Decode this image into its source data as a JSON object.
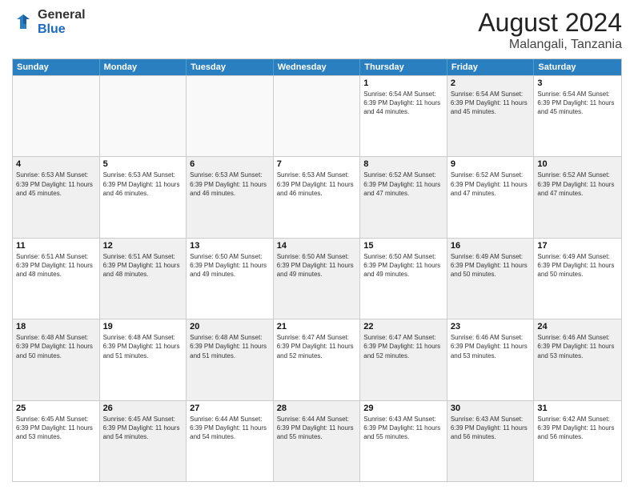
{
  "logo": {
    "general": "General",
    "blue": "Blue"
  },
  "title": {
    "month": "August 2024",
    "location": "Malangali, Tanzania"
  },
  "header_days": [
    "Sunday",
    "Monday",
    "Tuesday",
    "Wednesday",
    "Thursday",
    "Friday",
    "Saturday"
  ],
  "weeks": [
    [
      {
        "day": "",
        "info": "",
        "empty": true
      },
      {
        "day": "",
        "info": "",
        "empty": true
      },
      {
        "day": "",
        "info": "",
        "empty": true
      },
      {
        "day": "",
        "info": "",
        "empty": true
      },
      {
        "day": "1",
        "info": "Sunrise: 6:54 AM\nSunset: 6:39 PM\nDaylight: 11 hours\nand 44 minutes."
      },
      {
        "day": "2",
        "info": "Sunrise: 6:54 AM\nSunset: 6:39 PM\nDaylight: 11 hours\nand 45 minutes.",
        "shaded": true
      },
      {
        "day": "3",
        "info": "Sunrise: 6:54 AM\nSunset: 6:39 PM\nDaylight: 11 hours\nand 45 minutes."
      }
    ],
    [
      {
        "day": "4",
        "info": "Sunrise: 6:53 AM\nSunset: 6:39 PM\nDaylight: 11 hours\nand 45 minutes.",
        "shaded": true
      },
      {
        "day": "5",
        "info": "Sunrise: 6:53 AM\nSunset: 6:39 PM\nDaylight: 11 hours\nand 46 minutes."
      },
      {
        "day": "6",
        "info": "Sunrise: 6:53 AM\nSunset: 6:39 PM\nDaylight: 11 hours\nand 46 minutes.",
        "shaded": true
      },
      {
        "day": "7",
        "info": "Sunrise: 6:53 AM\nSunset: 6:39 PM\nDaylight: 11 hours\nand 46 minutes."
      },
      {
        "day": "8",
        "info": "Sunrise: 6:52 AM\nSunset: 6:39 PM\nDaylight: 11 hours\nand 47 minutes.",
        "shaded": true
      },
      {
        "day": "9",
        "info": "Sunrise: 6:52 AM\nSunset: 6:39 PM\nDaylight: 11 hours\nand 47 minutes."
      },
      {
        "day": "10",
        "info": "Sunrise: 6:52 AM\nSunset: 6:39 PM\nDaylight: 11 hours\nand 47 minutes.",
        "shaded": true
      }
    ],
    [
      {
        "day": "11",
        "info": "Sunrise: 6:51 AM\nSunset: 6:39 PM\nDaylight: 11 hours\nand 48 minutes."
      },
      {
        "day": "12",
        "info": "Sunrise: 6:51 AM\nSunset: 6:39 PM\nDaylight: 11 hours\nand 48 minutes.",
        "shaded": true
      },
      {
        "day": "13",
        "info": "Sunrise: 6:50 AM\nSunset: 6:39 PM\nDaylight: 11 hours\nand 49 minutes."
      },
      {
        "day": "14",
        "info": "Sunrise: 6:50 AM\nSunset: 6:39 PM\nDaylight: 11 hours\nand 49 minutes.",
        "shaded": true
      },
      {
        "day": "15",
        "info": "Sunrise: 6:50 AM\nSunset: 6:39 PM\nDaylight: 11 hours\nand 49 minutes."
      },
      {
        "day": "16",
        "info": "Sunrise: 6:49 AM\nSunset: 6:39 PM\nDaylight: 11 hours\nand 50 minutes.",
        "shaded": true
      },
      {
        "day": "17",
        "info": "Sunrise: 6:49 AM\nSunset: 6:39 PM\nDaylight: 11 hours\nand 50 minutes."
      }
    ],
    [
      {
        "day": "18",
        "info": "Sunrise: 6:48 AM\nSunset: 6:39 PM\nDaylight: 11 hours\nand 50 minutes.",
        "shaded": true
      },
      {
        "day": "19",
        "info": "Sunrise: 6:48 AM\nSunset: 6:39 PM\nDaylight: 11 hours\nand 51 minutes."
      },
      {
        "day": "20",
        "info": "Sunrise: 6:48 AM\nSunset: 6:39 PM\nDaylight: 11 hours\nand 51 minutes.",
        "shaded": true
      },
      {
        "day": "21",
        "info": "Sunrise: 6:47 AM\nSunset: 6:39 PM\nDaylight: 11 hours\nand 52 minutes."
      },
      {
        "day": "22",
        "info": "Sunrise: 6:47 AM\nSunset: 6:39 PM\nDaylight: 11 hours\nand 52 minutes.",
        "shaded": true
      },
      {
        "day": "23",
        "info": "Sunrise: 6:46 AM\nSunset: 6:39 PM\nDaylight: 11 hours\nand 53 minutes."
      },
      {
        "day": "24",
        "info": "Sunrise: 6:46 AM\nSunset: 6:39 PM\nDaylight: 11 hours\nand 53 minutes.",
        "shaded": true
      }
    ],
    [
      {
        "day": "25",
        "info": "Sunrise: 6:45 AM\nSunset: 6:39 PM\nDaylight: 11 hours\nand 53 minutes."
      },
      {
        "day": "26",
        "info": "Sunrise: 6:45 AM\nSunset: 6:39 PM\nDaylight: 11 hours\nand 54 minutes.",
        "shaded": true
      },
      {
        "day": "27",
        "info": "Sunrise: 6:44 AM\nSunset: 6:39 PM\nDaylight: 11 hours\nand 54 minutes."
      },
      {
        "day": "28",
        "info": "Sunrise: 6:44 AM\nSunset: 6:39 PM\nDaylight: 11 hours\nand 55 minutes.",
        "shaded": true
      },
      {
        "day": "29",
        "info": "Sunrise: 6:43 AM\nSunset: 6:39 PM\nDaylight: 11 hours\nand 55 minutes."
      },
      {
        "day": "30",
        "info": "Sunrise: 6:43 AM\nSunset: 6:39 PM\nDaylight: 11 hours\nand 56 minutes.",
        "shaded": true
      },
      {
        "day": "31",
        "info": "Sunrise: 6:42 AM\nSunset: 6:39 PM\nDaylight: 11 hours\nand 56 minutes."
      }
    ]
  ]
}
